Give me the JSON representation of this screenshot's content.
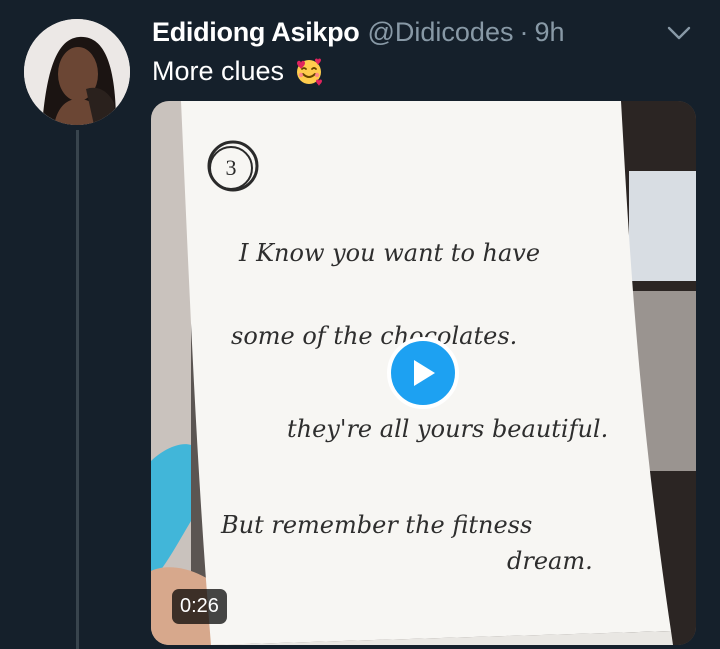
{
  "tweet": {
    "author_name": "Edidiong Asikpo",
    "handle": "@Didicodes",
    "separator": "·",
    "time": "9h",
    "text": "More clues",
    "emoji": "smiling-face-with-hearts",
    "avatar_icon": "user-avatar"
  },
  "media": {
    "type": "video",
    "duration": "0:26",
    "note": {
      "number": "3",
      "lines": [
        "I Know you want to have",
        "some of the chocolates.",
        "they're all yours beautiful.",
        "But remember the fitness",
        "dream."
      ]
    }
  },
  "colors": {
    "background": "#15202b",
    "text_primary": "#ffffff",
    "text_secondary": "#8899a6",
    "accent": "#1da1f2",
    "thread_line": "#38444d"
  }
}
